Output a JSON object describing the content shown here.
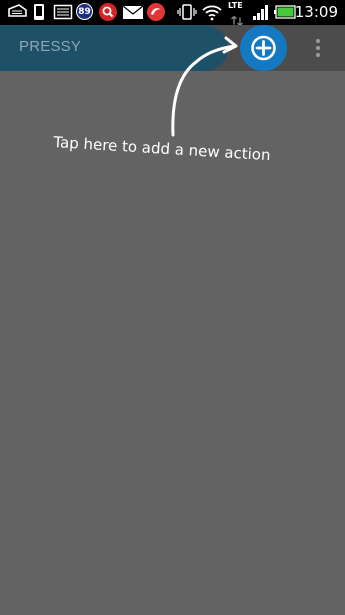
{
  "status_bar": {
    "time": "13:09",
    "notification_badge": "89",
    "network_label": "LTE",
    "icons": [
      "keyboard-icon",
      "phone-icon",
      "photo-icon",
      "notification-count-icon",
      "search-app-icon",
      "mail-icon",
      "app-icon",
      "vibrate-icon",
      "wifi-icon",
      "lte-icon",
      "signal-icon",
      "battery-icon"
    ],
    "battery_color": "#46c93a"
  },
  "action_bar": {
    "title": "PRESSY",
    "add_icon": "plus-circle-icon",
    "overflow_icon": "overflow-menu-icon",
    "accent": "#1479c1"
  },
  "hint": {
    "text": "Tap here to add a new action"
  }
}
